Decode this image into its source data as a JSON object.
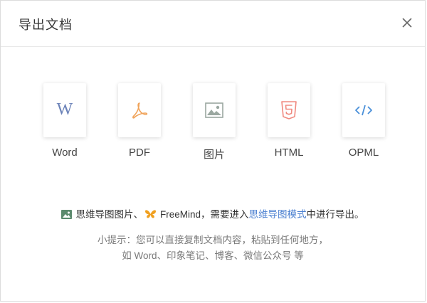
{
  "dialog": {
    "title": "导出文档",
    "close_icon": "close-icon"
  },
  "formats": [
    {
      "label": "Word",
      "icon": "word-icon",
      "glyph": "W"
    },
    {
      "label": "PDF",
      "icon": "pdf-icon"
    },
    {
      "label": "图片",
      "icon": "image-icon"
    },
    {
      "label": "HTML",
      "icon": "html5-icon"
    },
    {
      "label": "OPML",
      "icon": "code-icon"
    }
  ],
  "note": {
    "part1": "思维导图图片、",
    "part2": "FreeMind，需要进入",
    "link": "思维导图模式",
    "part3": "中进行导出。"
  },
  "tips": {
    "line1": "小提示：您可以直接复制文档内容，粘贴到任何地方，",
    "line2": "如 Word、印象笔记、博客、微信公众号 等"
  },
  "colors": {
    "word": "#6b82b8",
    "pdf": "#f0a35a",
    "image": "#9aa7a0",
    "html": "#f08a80",
    "code": "#4a90d9",
    "link": "#4a7fd0"
  }
}
